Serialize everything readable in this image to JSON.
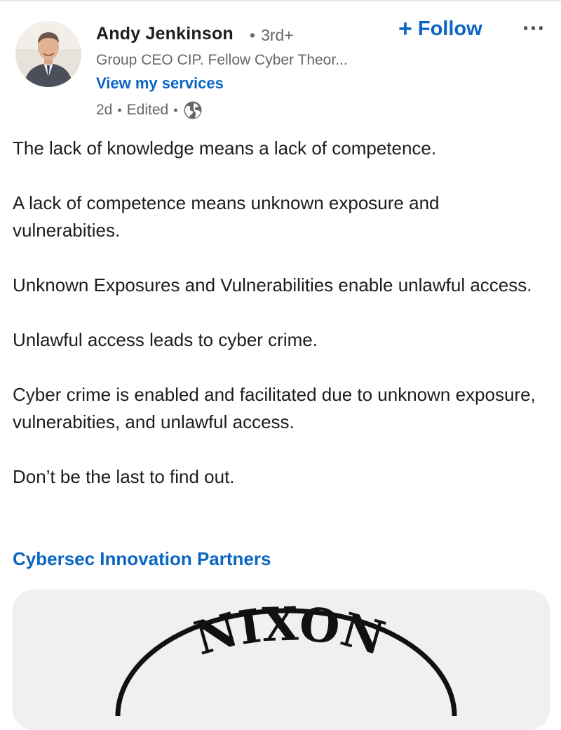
{
  "post": {
    "author": {
      "name": "Andy Jenkinson",
      "degree": "3rd+",
      "headline": "Group CEO CIP. Fellow Cyber Theor...",
      "services_link": "View my services",
      "avatar_icon": "profile-photo"
    },
    "meta": {
      "age": "2d",
      "edited": "Edited",
      "visibility_icon": "globe-icon"
    },
    "actions": {
      "follow_label": "Follow",
      "follow_icon": "plus-icon",
      "more_icon": "ellipsis-icon"
    },
    "paragraphs": [
      "The lack of knowledge means a lack of competence.",
      "A lack of competence means unknown exposure and vulnerabities.",
      "Unknown Exposures and Vulnerabilities enable unlawful access.",
      "Unlawful access leads to cyber crime.",
      "Cyber crime is enabled and facilitated due to unknown exposure, vulnerabities, and unlawful access.",
      "Don’t be the last to find out."
    ],
    "company_link": "Cybersec Innovation Partners",
    "image": {
      "logo_text": "NIXON"
    }
  },
  "colors": {
    "link_blue": "#0a66c2",
    "text_primary": "#1d1d1d",
    "text_secondary": "#666666",
    "image_background": "#f0f0f0"
  }
}
